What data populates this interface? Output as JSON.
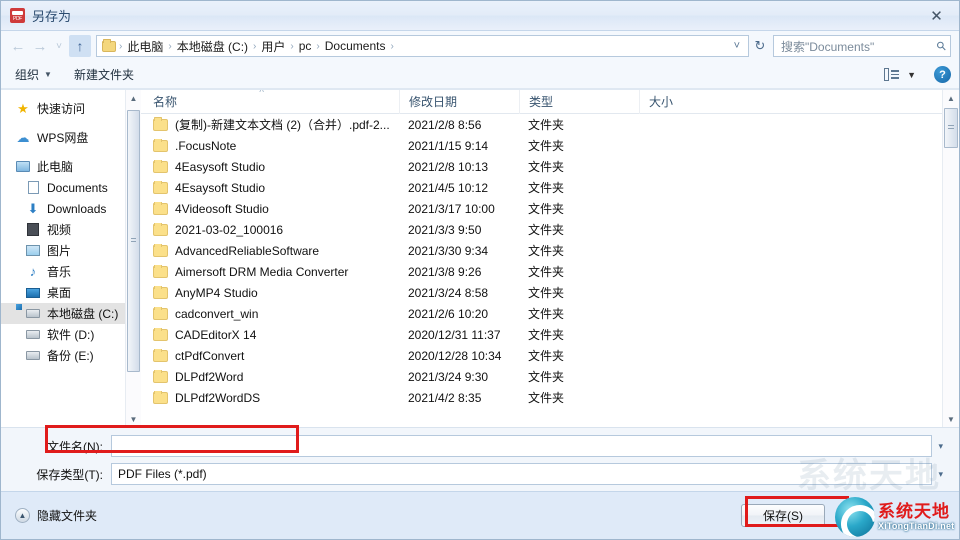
{
  "window": {
    "title": "另存为",
    "app_icon": "pdf-icon",
    "close_label": "✕"
  },
  "addressbar": {
    "back_icon": "←",
    "forward_icon": "→",
    "history_icon": "˅",
    "up_icon": "↑",
    "crumbs": [
      "此电脑",
      "本地磁盘 (C:)",
      "用户",
      "pc",
      "Documents"
    ],
    "separator": "›",
    "dropdown_icon": "˅",
    "refresh_icon": "↻",
    "search_placeholder": "搜索\"Documents\"",
    "search_icon": "search-icon"
  },
  "toolbar": {
    "organize_label": "组织",
    "organize_caret": "▼",
    "new_folder_label": "新建文件夹",
    "view_caret": "▼",
    "help_label": "?"
  },
  "sidebar": {
    "items": [
      {
        "label": "快速访问",
        "icon": "star-icon",
        "indent": false,
        "selected": false
      },
      {
        "label": "WPS网盘",
        "icon": "cloud-icon",
        "indent": false,
        "selected": false
      },
      {
        "label": "此电脑",
        "icon": "computer-icon",
        "indent": false,
        "selected": false
      },
      {
        "label": "Documents",
        "icon": "documents-icon",
        "indent": true,
        "selected": false
      },
      {
        "label": "Downloads",
        "icon": "downloads-icon",
        "indent": true,
        "selected": false
      },
      {
        "label": "视频",
        "icon": "videos-icon",
        "indent": true,
        "selected": false
      },
      {
        "label": "图片",
        "icon": "pictures-icon",
        "indent": true,
        "selected": false
      },
      {
        "label": "音乐",
        "icon": "music-icon",
        "indent": true,
        "selected": false
      },
      {
        "label": "桌面",
        "icon": "desktop-icon",
        "indent": true,
        "selected": false
      },
      {
        "label": "本地磁盘 (C:)",
        "icon": "drive-windows-icon",
        "indent": true,
        "selected": true
      },
      {
        "label": "软件 (D:)",
        "icon": "drive-icon",
        "indent": true,
        "selected": false
      },
      {
        "label": "备份 (E:)",
        "icon": "drive-icon",
        "indent": true,
        "selected": false
      }
    ]
  },
  "filelist": {
    "columns": [
      "名称",
      "修改日期",
      "类型",
      "大小"
    ],
    "sort_indicator": "˄",
    "rows": [
      {
        "name": "(复制)-新建文本文档 (2)（合并）.pdf-2...",
        "date": "2021/2/8 8:56",
        "type": "文件夹",
        "size": ""
      },
      {
        "name": ".FocusNote",
        "date": "2021/1/15 9:14",
        "type": "文件夹",
        "size": ""
      },
      {
        "name": "4Easysoft Studio",
        "date": "2021/2/8 10:13",
        "type": "文件夹",
        "size": ""
      },
      {
        "name": "4Esaysoft Studio",
        "date": "2021/4/5 10:12",
        "type": "文件夹",
        "size": ""
      },
      {
        "name": "4Videosoft Studio",
        "date": "2021/3/17 10:00",
        "type": "文件夹",
        "size": ""
      },
      {
        "name": "2021-03-02_100016",
        "date": "2021/3/3 9:50",
        "type": "文件夹",
        "size": ""
      },
      {
        "name": "AdvancedReliableSoftware",
        "date": "2021/3/30 9:34",
        "type": "文件夹",
        "size": ""
      },
      {
        "name": "Aimersoft DRM Media Converter",
        "date": "2021/3/8 9:26",
        "type": "文件夹",
        "size": ""
      },
      {
        "name": "AnyMP4 Studio",
        "date": "2021/3/24 8:58",
        "type": "文件夹",
        "size": ""
      },
      {
        "name": "cadconvert_win",
        "date": "2021/2/6 10:20",
        "type": "文件夹",
        "size": ""
      },
      {
        "name": "CADEditorX 14",
        "date": "2020/12/31 11:37",
        "type": "文件夹",
        "size": ""
      },
      {
        "name": "ctPdfConvert",
        "date": "2020/12/28 10:34",
        "type": "文件夹",
        "size": ""
      },
      {
        "name": "DLPdf2Word",
        "date": "2021/3/24 9:30",
        "type": "文件夹",
        "size": ""
      },
      {
        "name": "DLPdf2WordDS",
        "date": "2021/4/2 8:35",
        "type": "文件夹",
        "size": ""
      }
    ]
  },
  "form": {
    "filename_label": "文件名(N):",
    "filename_value": "",
    "filetype_label": "保存类型(T):",
    "filetype_value": "PDF Files (*.pdf)",
    "dropdown_icon": "▾"
  },
  "footer": {
    "hide_folders_label": "隐藏文件夹",
    "hide_folders_icon": "▲",
    "save_label": "保存(S)"
  },
  "watermark": {
    "brand_cn": "系统天地",
    "brand_en": "XiTongTianDi.net",
    "ghost_text": "系统天地"
  },
  "colors": {
    "accent": "#cfe0f3",
    "annotation": "#e01b1b",
    "brand_red": "#e01b1b",
    "footer_bg": "#dfeaf8"
  }
}
